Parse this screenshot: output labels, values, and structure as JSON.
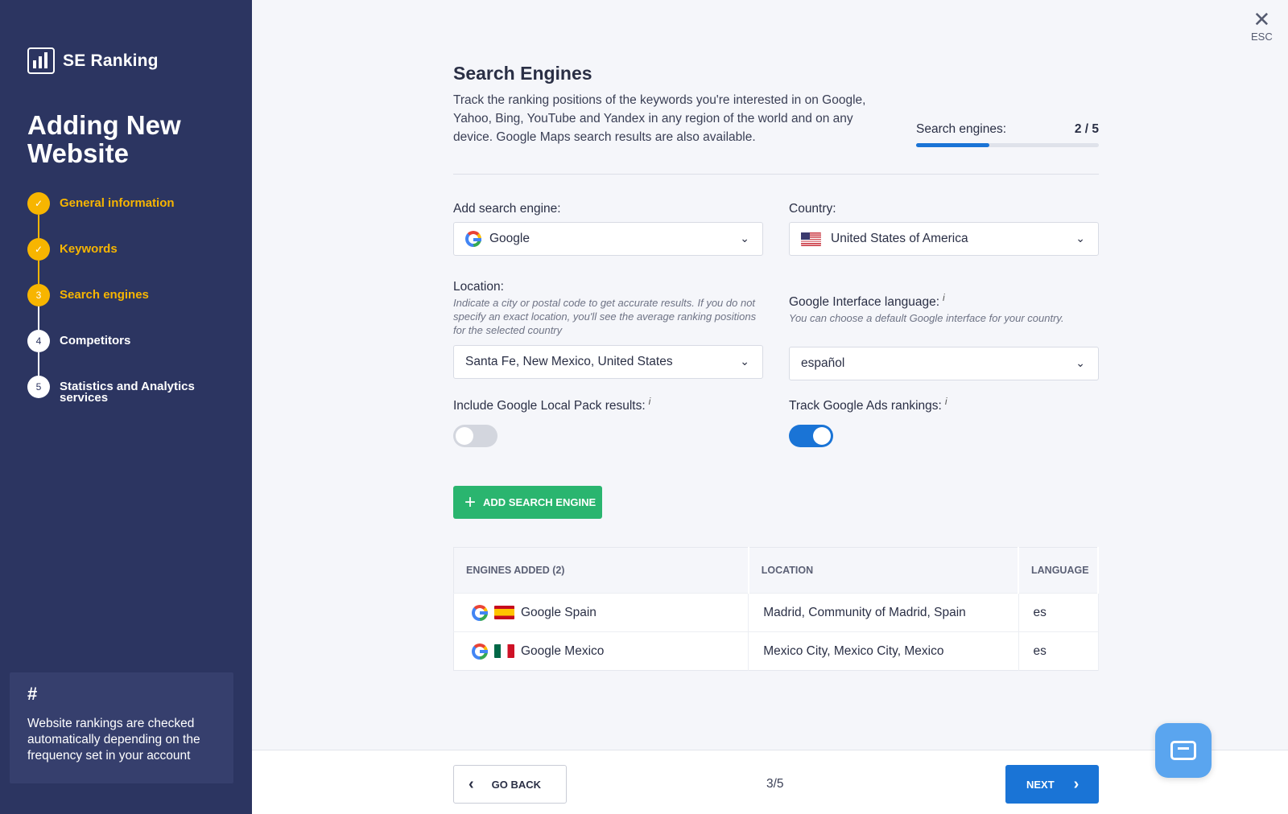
{
  "sidebar": {
    "brand": "SE Ranking",
    "title": "Adding New Website",
    "steps": [
      {
        "label": "General information",
        "badge": "✓"
      },
      {
        "label": "Keywords",
        "badge": "✓"
      },
      {
        "label": "Search engines",
        "badge": "3"
      },
      {
        "label": "Competitors",
        "badge": "4"
      },
      {
        "label": "Statistics and Analytics services",
        "badge": "5"
      }
    ],
    "tip": {
      "icon": "#",
      "text": "Website rankings are checked automatically depending on the frequency set in your account"
    }
  },
  "close": {
    "icon": "✕",
    "label": "ESC"
  },
  "section": {
    "title": "Search Engines",
    "description": "Track the ranking positions of the keywords you're interested in on Google, Yahoo, Bing, YouTube and Yandex in any region of the world and on any device. Google Maps search results are also available."
  },
  "progress": {
    "label": "Search engines:",
    "count": "2 / 5",
    "fraction": 0.4
  },
  "form": {
    "engine": {
      "label": "Add search engine:",
      "value": "Google"
    },
    "country": {
      "label": "Country:",
      "value": "United States of America"
    },
    "location": {
      "label": "Location:",
      "hint": "Indicate a city or postal code to get accurate results. If you do not specify an exact location, you'll see the average ranking positions for the selected country",
      "value": "Santa Fe, New Mexico, United States"
    },
    "language": {
      "label": "Google Interface language:",
      "hint": "You can choose a default Google interface for your country.",
      "value": "español"
    },
    "local_pack": {
      "label": "Include Google Local Pack results:",
      "enabled": false
    },
    "ads": {
      "label": "Track Google Ads rankings:",
      "enabled": true
    },
    "info_icon": "i"
  },
  "add_button": {
    "icon": "+",
    "label": "ADD SEARCH ENGINE"
  },
  "table": {
    "headers": [
      "ENGINES ADDED (2)",
      "LOCATION",
      "LANGUAGE"
    ],
    "rows": [
      {
        "engine": "Google Spain",
        "location": "Madrid, Community of Madrid, Spain",
        "language": "es",
        "flag": "spain-flag-icon"
      },
      {
        "engine": "Google Mexico",
        "location": "Mexico City, Mexico City, Mexico",
        "language": "es",
        "flag": "mexico-flag-icon"
      }
    ]
  },
  "footer": {
    "back_label": "GO BACK",
    "back_icon": "‹",
    "pager": "3/5",
    "next_label": "NEXT",
    "next_icon": "›"
  },
  "colors": {
    "sidebar": "#2c3561",
    "accent": "#f7b500",
    "primary": "#1a74d6",
    "success": "#2ab56f"
  }
}
